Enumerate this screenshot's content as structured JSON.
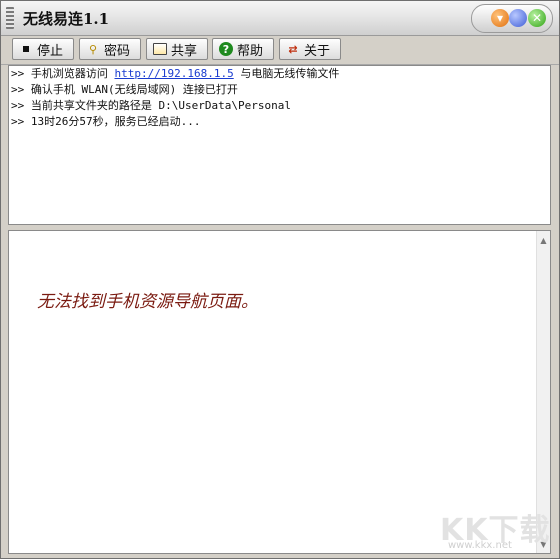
{
  "window": {
    "title": "无线易连1.1"
  },
  "toolbar": {
    "stop_label": "停止",
    "password_label": "密码",
    "share_label": "共享",
    "help_label": "帮助",
    "about_label": "关于"
  },
  "log": {
    "lines": [
      {
        "prefix": ">>",
        "before": "手机浏览器访问 ",
        "link": "http://192.168.1.5",
        "after": " 与电脑无线传输文件"
      },
      {
        "prefix": ">>",
        "text": "确认手机 WLAN(无线局域网) 连接已打开"
      },
      {
        "prefix": ">>",
        "text": "当前共享文件夹的路径是 D:\\UserData\\Personal"
      },
      {
        "prefix": ">>",
        "text": "13时26分57秒，服务已经启动..."
      }
    ]
  },
  "viewer": {
    "message": "无法找到手机资源导航页面。"
  },
  "watermark": {
    "brand": "KK下载",
    "url": "www.kkx.net"
  },
  "icons": {
    "stop": "stop-icon",
    "password": "key-icon",
    "share": "folder-icon",
    "help": "help-icon",
    "about": "about-icon"
  }
}
